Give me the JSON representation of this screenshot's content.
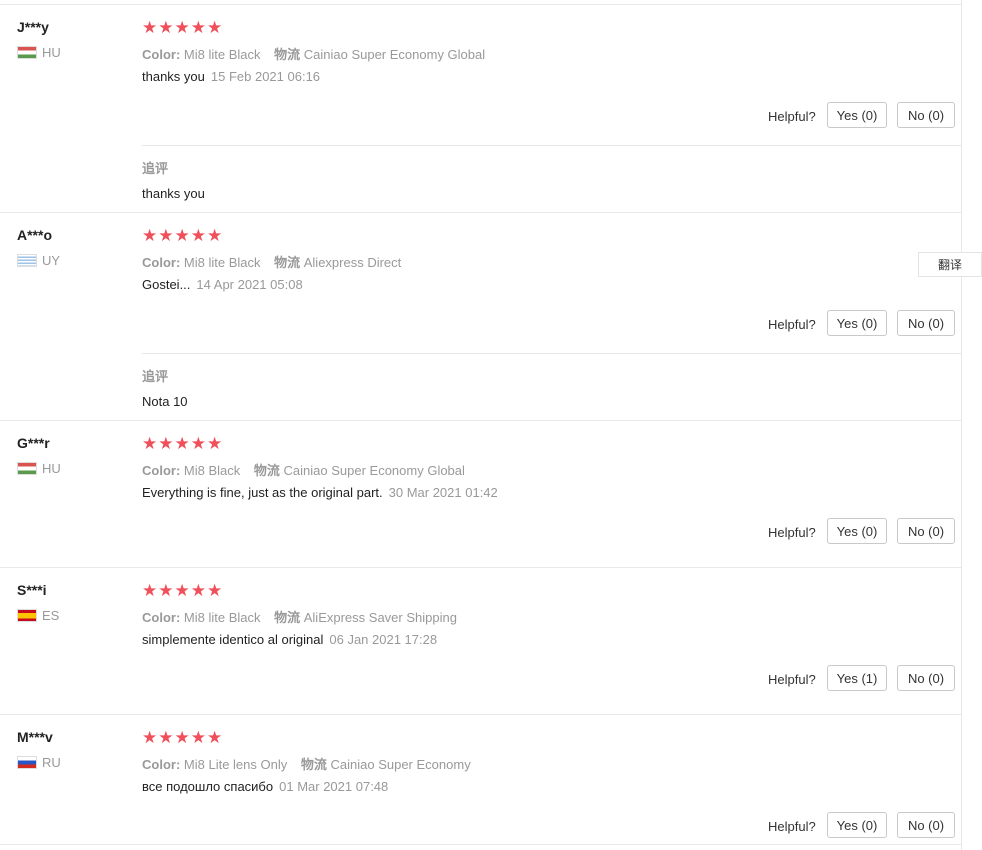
{
  "reviews": [
    {
      "user": "J***y",
      "country": "HU",
      "color_label": "Color:",
      "color_value": "Mi8 lite Black",
      "shipping_label": "物流",
      "shipping_value": "Cainiao Super Economy Global",
      "text": "thanks you",
      "date": "15 Feb 2021 06:16",
      "helpful_label": "Helpful?",
      "yes": "Yes (0)",
      "no": "No (0)",
      "followup_label": "追评",
      "followup_text": "thanks you"
    },
    {
      "user": "A***o",
      "country": "UY",
      "color_label": "Color:",
      "color_value": "Mi8 lite Black",
      "shipping_label": "物流",
      "shipping_value": "Aliexpress Direct",
      "text": "Gostei...",
      "date": "14 Apr 2021 05:08",
      "helpful_label": "Helpful?",
      "yes": "Yes (0)",
      "no": "No (0)",
      "followup_label": "追评",
      "followup_text": "Nota 10"
    },
    {
      "user": "G***r",
      "country": "HU",
      "color_label": "Color:",
      "color_value": "Mi8 Black",
      "shipping_label": "物流",
      "shipping_value": "Cainiao Super Economy Global",
      "text": "Everything is fine, just as the original part.",
      "date": "30 Mar 2021 01:42",
      "helpful_label": "Helpful?",
      "yes": "Yes (0)",
      "no": "No (0)"
    },
    {
      "user": "S***i",
      "country": "ES",
      "color_label": "Color:",
      "color_value": "Mi8 lite Black",
      "shipping_label": "物流",
      "shipping_value": "AliExpress Saver Shipping",
      "text": "simplemente identico al original",
      "date": "06 Jan 2021 17:28",
      "helpful_label": "Helpful?",
      "yes": "Yes (1)",
      "no": "No (0)"
    },
    {
      "user": "M***v",
      "country": "RU",
      "color_label": "Color:",
      "color_value": "Mi8 Lite lens Only",
      "shipping_label": "物流",
      "shipping_value": "Cainiao Super Economy",
      "text": "все подошло спасибо",
      "date": "01 Mar 2021 07:48",
      "helpful_label": "Helpful?",
      "yes": "Yes (0)",
      "no": "No (0)"
    }
  ],
  "rating": "★★★★★",
  "translate_label": "翻译",
  "colors": {
    "star": "#f0505a",
    "muted": "#999999",
    "border": "#e8e8e8"
  }
}
